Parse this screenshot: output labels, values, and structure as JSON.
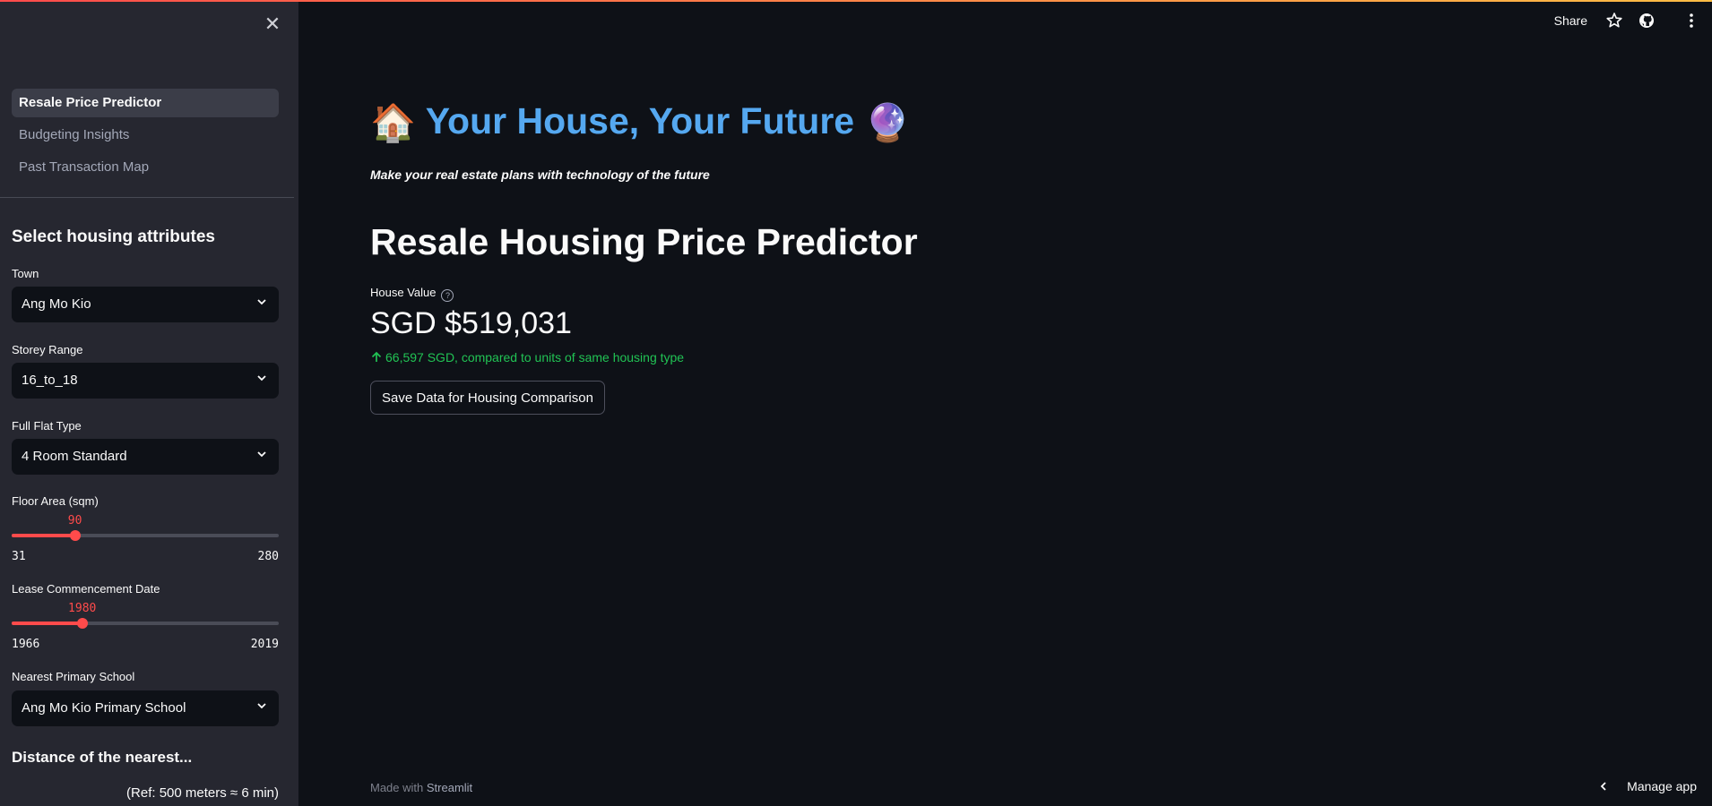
{
  "colors": {
    "accent": "#ff4b4b",
    "hero_blue": "#55a8f0",
    "delta_green": "#21c354",
    "sidebar_bg": "#262730",
    "main_bg": "#0e1117"
  },
  "sidebar": {
    "close_icon": "close-icon",
    "nav": [
      {
        "label": "Resale Price Predictor",
        "active": true
      },
      {
        "label": "Budgeting Insights",
        "active": false
      },
      {
        "label": "Past Transaction Map",
        "active": false
      }
    ],
    "section_title": "Select housing attributes",
    "town": {
      "label": "Town",
      "value": "Ang Mo Kio"
    },
    "storey": {
      "label": "Storey Range",
      "value": "16_to_18"
    },
    "flat_type": {
      "label": "Full Flat Type",
      "value": "4 Room Standard"
    },
    "floor_area": {
      "label": "Floor Area (sqm)",
      "value": 90,
      "min": 31,
      "max": 280
    },
    "lease": {
      "label": "Lease Commencement Date",
      "value": 1980,
      "min": 1966,
      "max": 2019
    },
    "school": {
      "label": "Nearest Primary School",
      "value": "Ang Mo Kio Primary School"
    },
    "distance_title": "Distance of the nearest...",
    "ref_note": "(Ref: 500 meters ≈ 6 min)"
  },
  "header": {
    "share_label": "Share",
    "icons": [
      "star-icon",
      "github-icon",
      "more-vertical-icon"
    ]
  },
  "main": {
    "hero_emoji_left": "🏠",
    "hero_text": "Your House, Your Future",
    "hero_emoji_right": "🔮",
    "tagline": "Make your real estate plans with technology of the future",
    "page_title": "Resale Housing Price Predictor",
    "metric_label": "House Value",
    "metric_value": "SGD $519,031",
    "metric_delta": "66,597 SGD, compared to units of same housing type",
    "save_button": "Save Data for Housing Comparison"
  },
  "footer": {
    "made_with": "Made with",
    "streamlit": "Streamlit",
    "manage_app": "Manage app"
  }
}
